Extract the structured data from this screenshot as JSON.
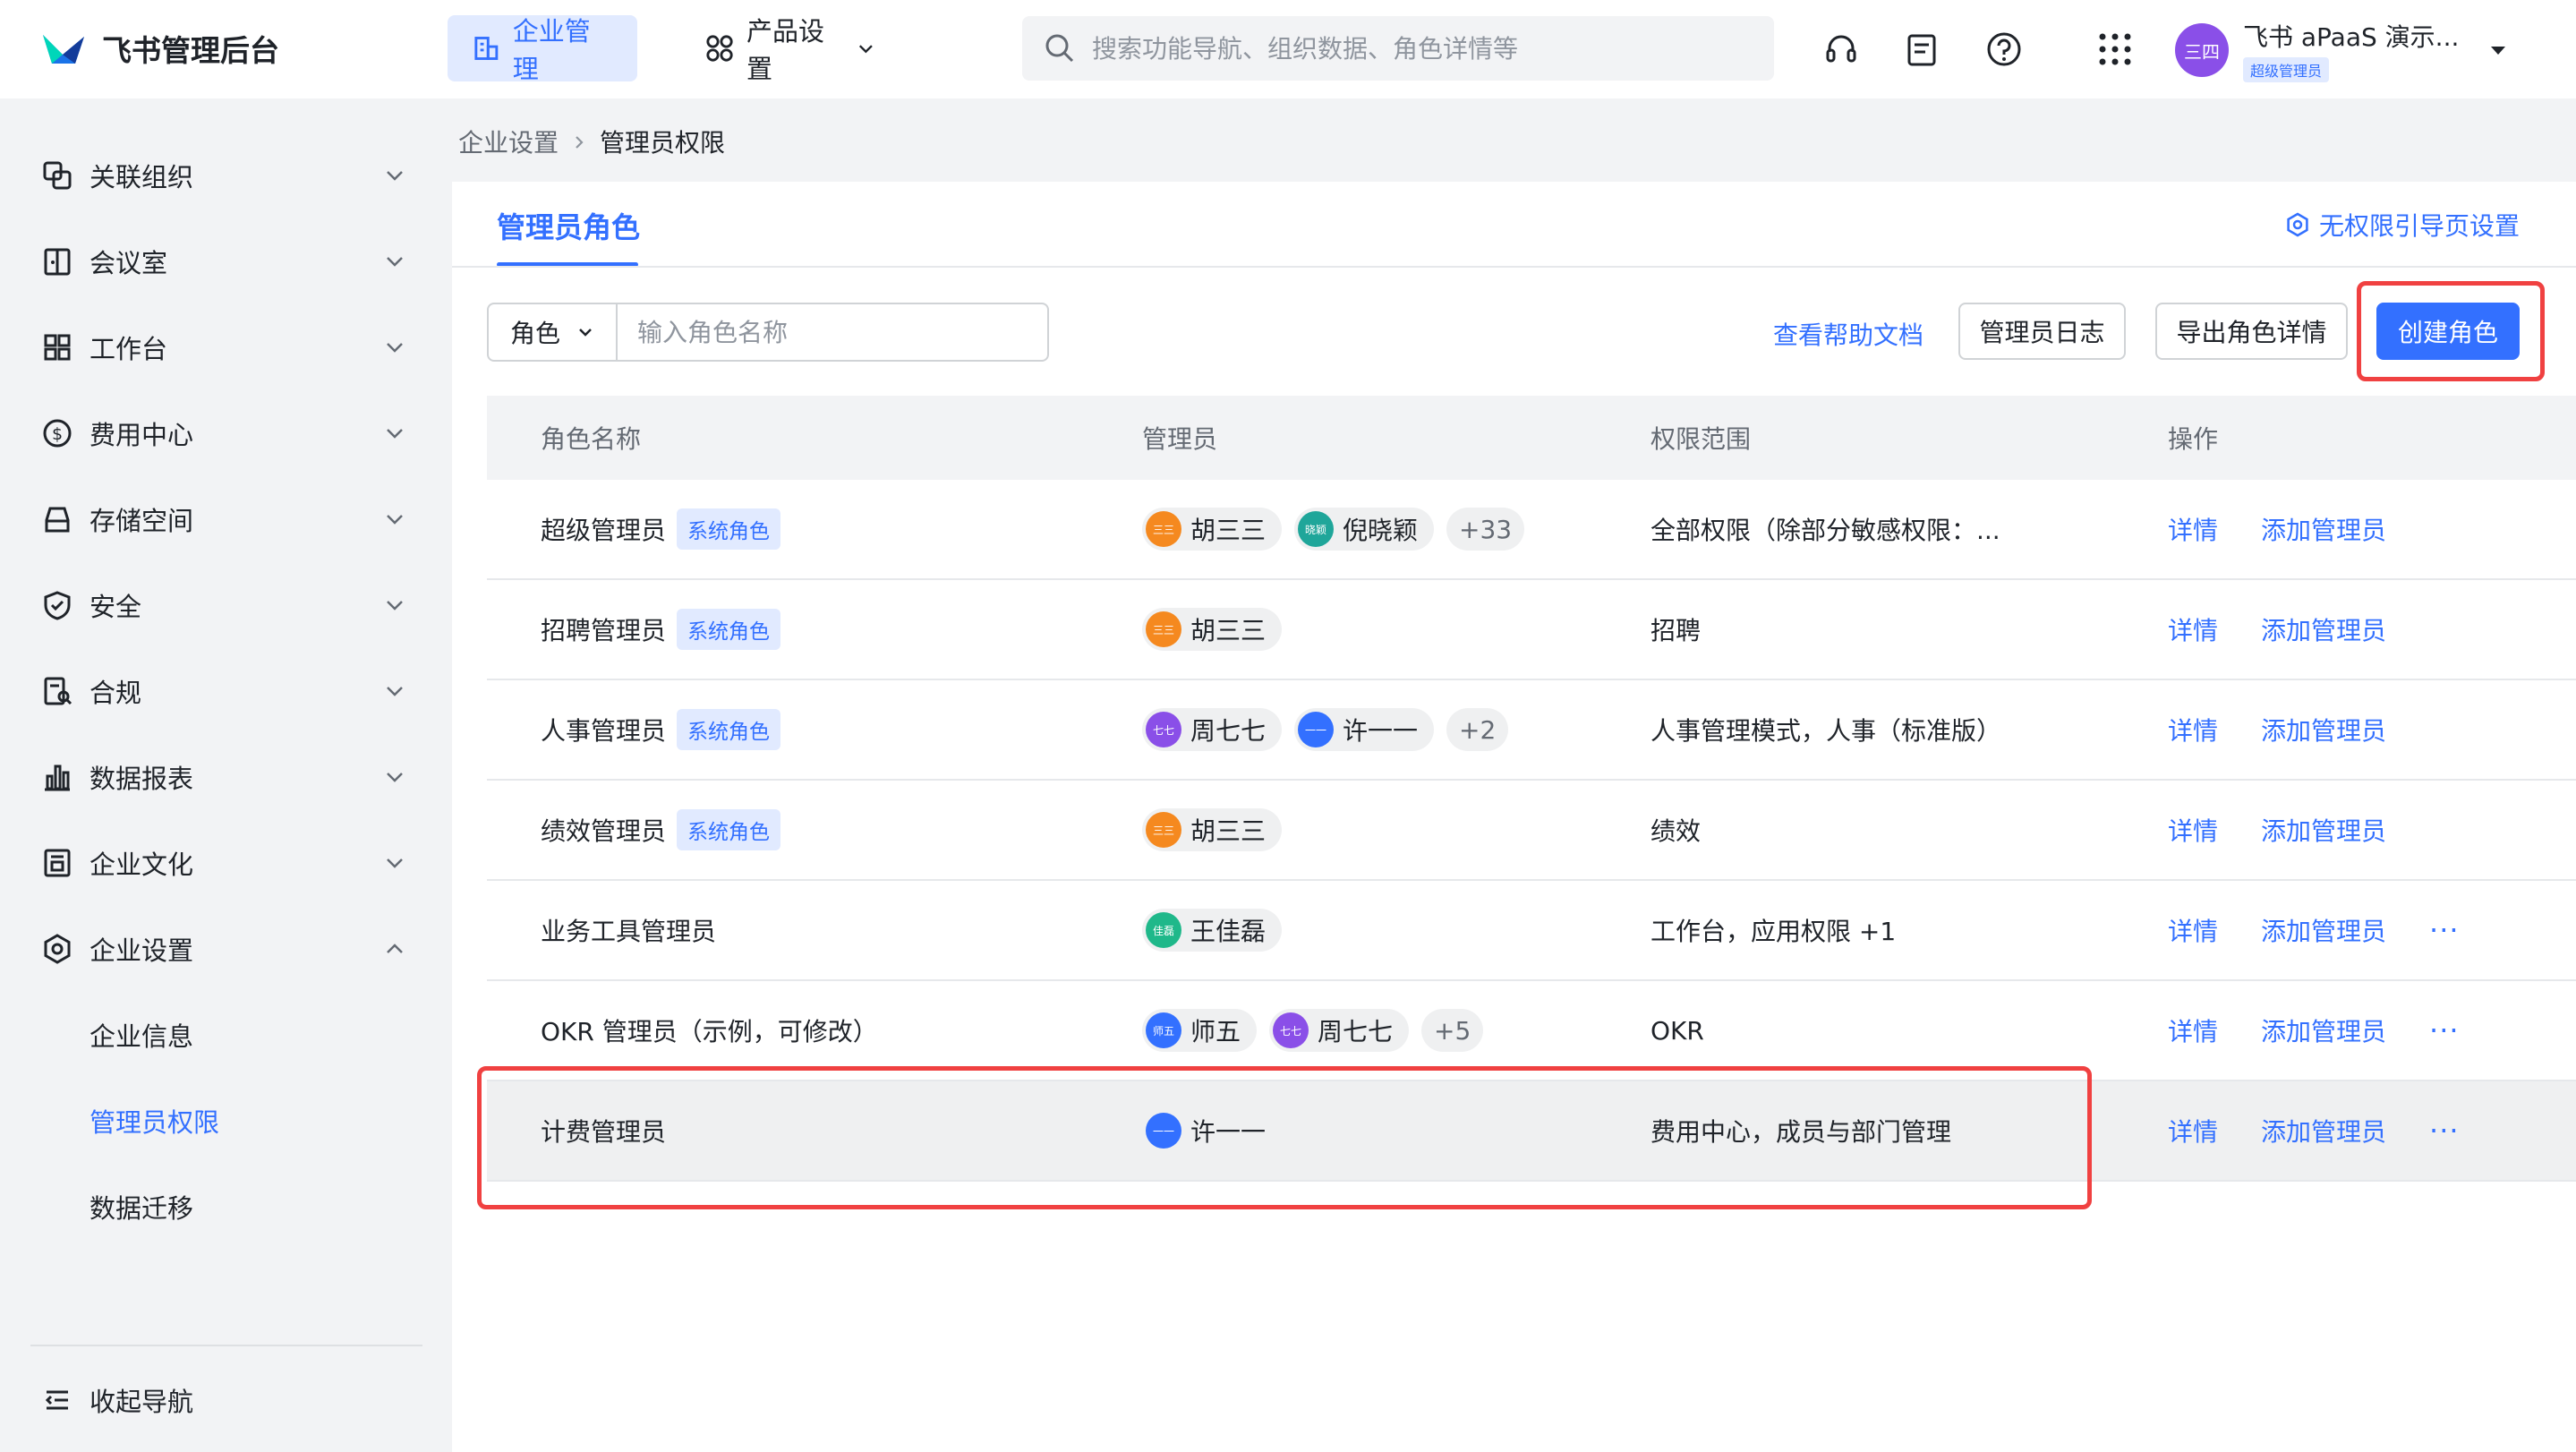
{
  "app": {
    "title": "飞书管理后台"
  },
  "topnav": {
    "enterprise": "企业管理",
    "product": "产品设置"
  },
  "search": {
    "placeholder": "搜索功能导航、组织数据、角色详情等"
  },
  "user": {
    "name": "飞书 aPaaS 演示...",
    "role": "超级管理员",
    "avatar_text": "三四",
    "avatar_color": "#8a4fe8"
  },
  "sidebar": {
    "items": [
      {
        "label": "关联组织",
        "icon": "link-org-icon"
      },
      {
        "label": "会议室",
        "icon": "meeting-room-icon"
      },
      {
        "label": "工作台",
        "icon": "grid-icon"
      },
      {
        "label": "费用中心",
        "icon": "dollar-icon"
      },
      {
        "label": "存储空间",
        "icon": "storage-icon"
      },
      {
        "label": "安全",
        "icon": "shield-icon"
      },
      {
        "label": "合规",
        "icon": "compliance-icon"
      },
      {
        "label": "数据报表",
        "icon": "chart-icon"
      },
      {
        "label": "企业文化",
        "icon": "culture-icon"
      },
      {
        "label": "企业设置",
        "icon": "settings-icon"
      }
    ],
    "sub_items": [
      "企业信息",
      "管理员权限",
      "数据迁移"
    ],
    "collapse": "收起导航"
  },
  "breadcrumb": {
    "parent": "企业设置",
    "current": "管理员权限"
  },
  "panel": {
    "tab": "管理员角色",
    "guide_link": "无权限引导页设置",
    "filter_select": "角色",
    "filter_placeholder": "输入角色名称",
    "help_link": "查看帮助文档",
    "btn_log": "管理员日志",
    "btn_export": "导出角色详情",
    "btn_create": "创建角色"
  },
  "table": {
    "headers": {
      "name": "角色名称",
      "admin": "管理员",
      "scope": "权限范围",
      "op": "操作"
    },
    "op_detail": "详情",
    "op_add": "添加管理员",
    "rows": [
      {
        "name": "超级管理员",
        "tag": "系统角色",
        "admins": [
          {
            "dot": "三三",
            "name": "胡三三",
            "color": "#f5891f"
          },
          {
            "dot": "晓颖",
            "name": "倪晓颖",
            "color": "#1fa69a"
          }
        ],
        "more": "+33",
        "scope": "全部权限（除部分敏感权限：...",
        "has_more": false
      },
      {
        "name": "招聘管理员",
        "tag": "系统角色",
        "admins": [
          {
            "dot": "三三",
            "name": "胡三三",
            "color": "#f5891f"
          }
        ],
        "more": "",
        "scope": "招聘",
        "has_more": false
      },
      {
        "name": "人事管理员",
        "tag": "系统角色",
        "admins": [
          {
            "dot": "七七",
            "name": "周七七",
            "color": "#8a4fe8"
          },
          {
            "dot": "一一",
            "name": "许一一",
            "color": "#3370ff"
          }
        ],
        "more": "+2",
        "scope": "人事管理模式，人事（标准版）",
        "has_more": false
      },
      {
        "name": "绩效管理员",
        "tag": "系统角色",
        "admins": [
          {
            "dot": "三三",
            "name": "胡三三",
            "color": "#f5891f"
          }
        ],
        "more": "",
        "scope": "绩效",
        "has_more": false
      },
      {
        "name": "业务工具管理员",
        "tag": "",
        "admins": [
          {
            "dot": "佳磊",
            "name": "王佳磊",
            "color": "#1fb88a"
          }
        ],
        "more": "",
        "scope": "工作台，应用权限 +1",
        "has_more": true
      },
      {
        "name": "OKR 管理员（示例，可修改）",
        "tag": "",
        "admins": [
          {
            "dot": "师五",
            "name": "师五",
            "color": "#3370ff"
          },
          {
            "dot": "七七",
            "name": "周七七",
            "color": "#8a4fe8"
          }
        ],
        "more": "+5",
        "scope": "OKR",
        "has_more": true
      },
      {
        "name": "计费管理员",
        "tag": "",
        "admins": [
          {
            "dot": "一一",
            "name": "许一一",
            "color": "#3370ff"
          }
        ],
        "more": "",
        "scope": "费用中心，成员与部门管理",
        "has_more": true
      }
    ]
  },
  "colors": {
    "accent": "#3370ff",
    "highlight": "#f04141"
  }
}
